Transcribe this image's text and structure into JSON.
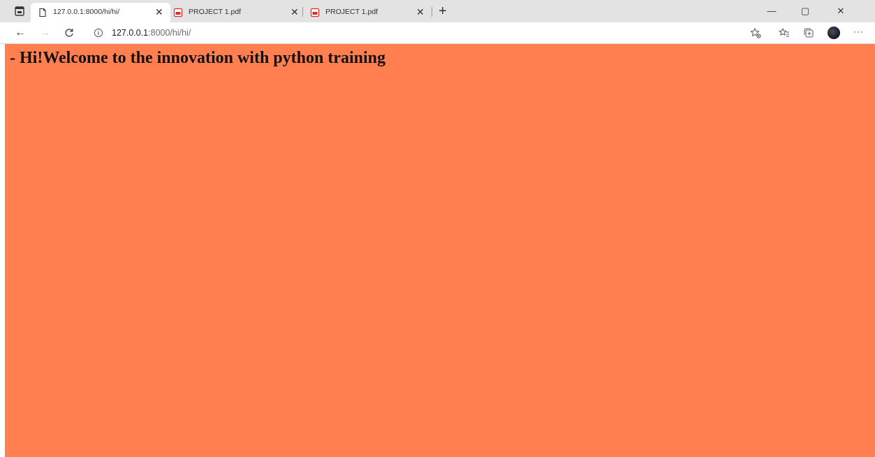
{
  "tabs": [
    {
      "title": "127.0.0.1:8000/hi/hi/",
      "icon": "page-icon",
      "active": true
    },
    {
      "title": "PROJECT 1.pdf",
      "icon": "pdf-icon",
      "active": false
    },
    {
      "title": "PROJECT 1.pdf",
      "icon": "pdf-icon",
      "active": false
    }
  ],
  "new_tab_label": "+",
  "window_controls": {
    "minimize": "—",
    "restore": "▢",
    "close": "✕"
  },
  "toolbar": {
    "back": "←",
    "forward": "→",
    "refresh": "C",
    "address": {
      "host": "127.0.0.1",
      "path": ":8000/hi/hi/"
    },
    "more": "···"
  },
  "page": {
    "heading": "- Hi!Welcome to the innovation with python training",
    "background_color": "#ff7f50"
  },
  "colors": {
    "tabstrip": "#e3e3e3",
    "pdf_icon": "#d93025"
  }
}
